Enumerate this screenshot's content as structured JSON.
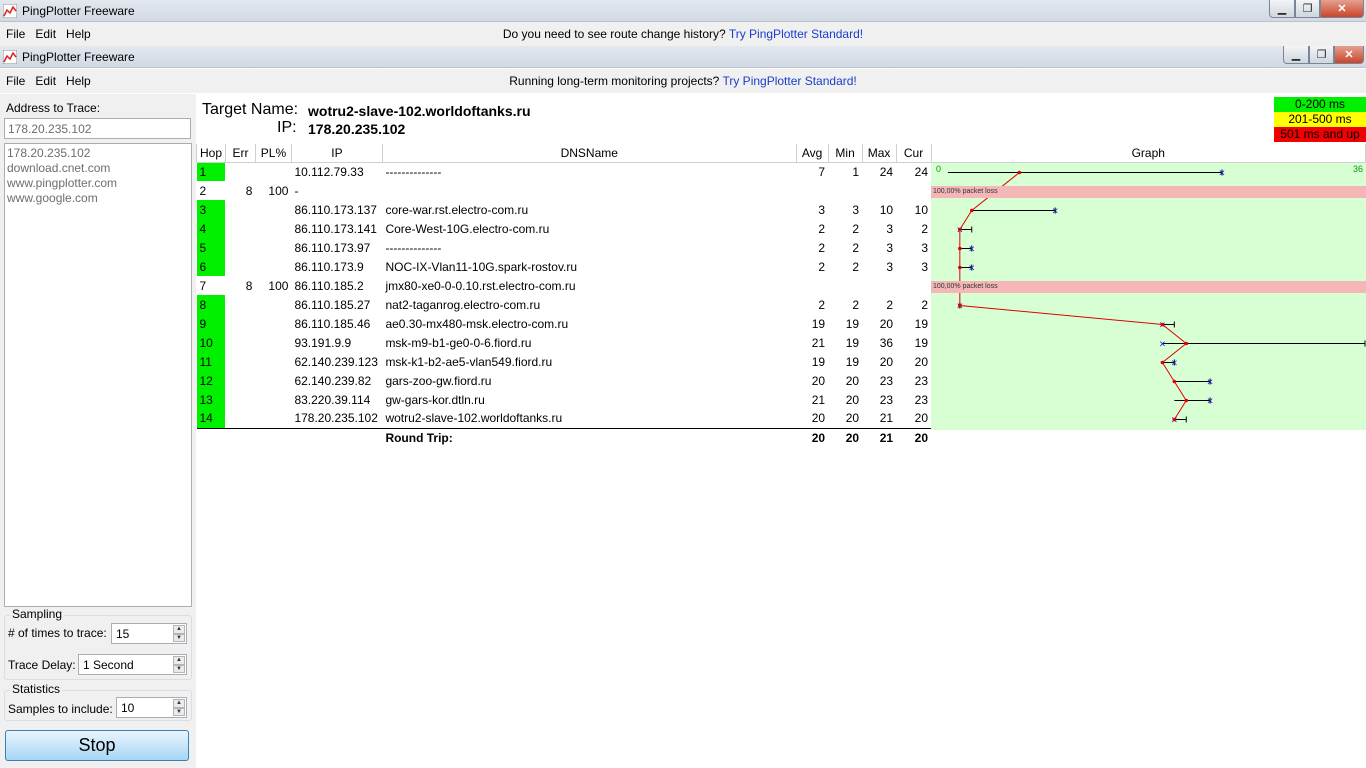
{
  "outer_window": {
    "title": "PingPlotter Freeware",
    "menu": [
      "File",
      "Edit",
      "Help"
    ],
    "promo_text": "Do you need to see route change history?",
    "promo_link": "Try PingPlotter Standard!"
  },
  "inner_window": {
    "title": "PingPlotter Freeware",
    "menu": [
      "File",
      "Edit",
      "Help"
    ],
    "promo_text": "Running long-term monitoring projects?",
    "promo_link": "Try PingPlotter Standard!"
  },
  "left_panel": {
    "address_label": "Address to Trace:",
    "address_value": "178.20.235.102",
    "history": [
      "178.20.235.102",
      "download.cnet.com",
      "www.pingplotter.com",
      "www.google.com"
    ],
    "sampling_title": "Sampling",
    "times_label": "# of times to trace:",
    "times_value": "15",
    "delay_label": "Trace Delay:",
    "delay_value": "1 Second",
    "statistics_title": "Statistics",
    "samples_label": "Samples to include:",
    "samples_value": "10",
    "stop_label": "Stop"
  },
  "target": {
    "name_label": "Target Name:",
    "name_value": "wotru2-slave-102.worldoftanks.ru",
    "ip_label": "IP:",
    "ip_value": "178.20.235.102"
  },
  "legend": [
    {
      "label": "0-200 ms",
      "color": "#00f000",
      "text_color": "#000000"
    },
    {
      "label": "201-500 ms",
      "color": "#ffff00",
      "text_color": "#000000"
    },
    {
      "label": "501 ms and up",
      "color": "#f00000",
      "text_color": "#000000"
    }
  ],
  "table": {
    "headers": [
      "Hop",
      "Err",
      "PL%",
      "IP",
      "DNSName",
      "Avg",
      "Min",
      "Max",
      "Cur",
      "Graph"
    ],
    "rows": [
      {
        "hop": "1",
        "err": "",
        "pl": "",
        "ip": "10.112.79.33",
        "dns": "--------------",
        "avg": "7",
        "min": "1",
        "max": "24",
        "cur": "24",
        "ok": true
      },
      {
        "hop": "2",
        "err": "8",
        "pl": "100",
        "ip": "-",
        "dns": "",
        "avg": "",
        "min": "",
        "max": "",
        "cur": "",
        "ok": false
      },
      {
        "hop": "3",
        "err": "",
        "pl": "",
        "ip": "86.110.173.137",
        "dns": "core-war.rst.electro-com.ru",
        "avg": "3",
        "min": "3",
        "max": "10",
        "cur": "10",
        "ok": true
      },
      {
        "hop": "4",
        "err": "",
        "pl": "",
        "ip": "86.110.173.141",
        "dns": "Core-West-10G.electro-com.ru",
        "avg": "2",
        "min": "2",
        "max": "3",
        "cur": "2",
        "ok": true
      },
      {
        "hop": "5",
        "err": "",
        "pl": "",
        "ip": "86.110.173.97",
        "dns": "--------------",
        "avg": "2",
        "min": "2",
        "max": "3",
        "cur": "3",
        "ok": true
      },
      {
        "hop": "6",
        "err": "",
        "pl": "",
        "ip": "86.110.173.9",
        "dns": "NOC-IX-Vlan11-10G.spark-rostov.ru",
        "avg": "2",
        "min": "2",
        "max": "3",
        "cur": "3",
        "ok": true
      },
      {
        "hop": "7",
        "err": "8",
        "pl": "100",
        "ip": "86.110.185.2",
        "dns": "jmx80-xe0-0-0.10.rst.electro-com.ru",
        "avg": "",
        "min": "",
        "max": "",
        "cur": "",
        "ok": false
      },
      {
        "hop": "8",
        "err": "",
        "pl": "",
        "ip": "86.110.185.27",
        "dns": "nat2-taganrog.electro-com.ru",
        "avg": "2",
        "min": "2",
        "max": "2",
        "cur": "2",
        "ok": true
      },
      {
        "hop": "9",
        "err": "",
        "pl": "",
        "ip": "86.110.185.46",
        "dns": "ae0.30-mx480-msk.electro-com.ru",
        "avg": "19",
        "min": "19",
        "max": "20",
        "cur": "19",
        "ok": true
      },
      {
        "hop": "10",
        "err": "",
        "pl": "",
        "ip": "93.191.9.9",
        "dns": "msk-m9-b1-ge0-0-6.fiord.ru",
        "avg": "21",
        "min": "19",
        "max": "36",
        "cur": "19",
        "ok": true
      },
      {
        "hop": "11",
        "err": "",
        "pl": "",
        "ip": "62.140.239.123",
        "dns": "msk-k1-b2-ae5-vlan549.fiord.ru",
        "avg": "19",
        "min": "19",
        "max": "20",
        "cur": "20",
        "ok": true
      },
      {
        "hop": "12",
        "err": "",
        "pl": "",
        "ip": "62.140.239.82",
        "dns": "gars-zoo-gw.fiord.ru",
        "avg": "20",
        "min": "20",
        "max": "23",
        "cur": "23",
        "ok": true
      },
      {
        "hop": "13",
        "err": "",
        "pl": "",
        "ip": "83.220.39.114",
        "dns": "gw-gars-kor.dtln.ru",
        "avg": "21",
        "min": "20",
        "max": "23",
        "cur": "23",
        "ok": true
      },
      {
        "hop": "14",
        "err": "",
        "pl": "",
        "ip": "178.20.235.102",
        "dns": "wotru2-slave-102.worldoftanks.ru",
        "avg": "20",
        "min": "20",
        "max": "21",
        "cur": "20",
        "ok": true
      }
    ],
    "round_trip": {
      "label": "Round Trip:",
      "avg": "20",
      "min": "20",
      "max": "21",
      "cur": "20"
    }
  },
  "graph": {
    "scale_min": "0",
    "scale_max": "36",
    "loss_label": "100,00% packet loss"
  }
}
